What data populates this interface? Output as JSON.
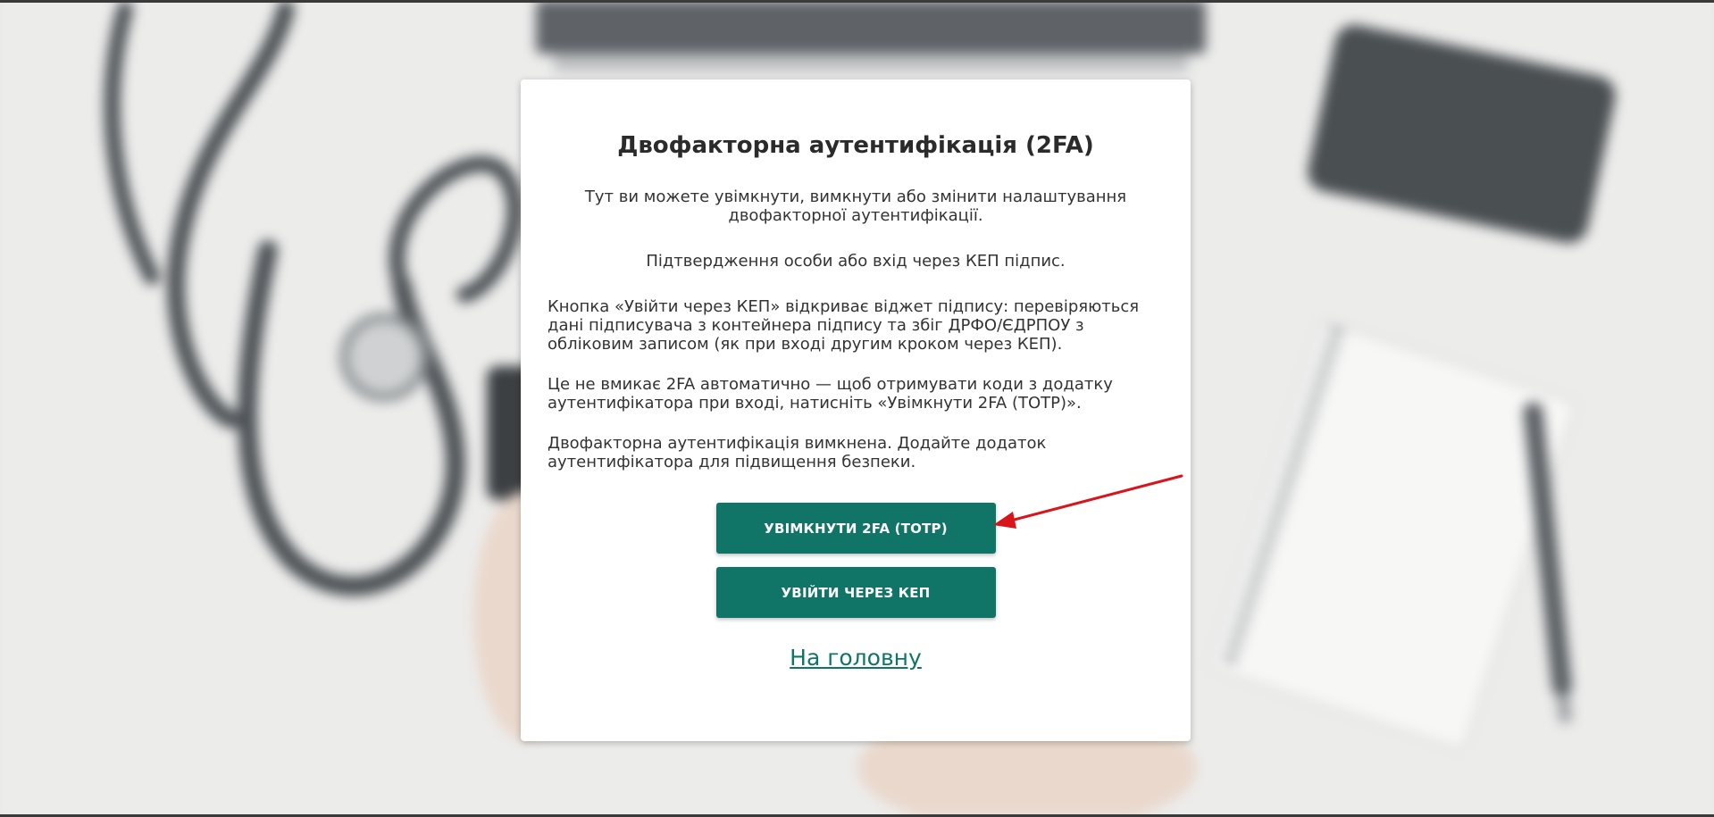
{
  "dialog": {
    "title": "Двофакторна аутентифікація (2FA)",
    "intro": "Тут ви можете увімкнути, вимкнути або змінити налаштування двофакторної аутентифікації.",
    "kep_line": "Підтвердження особи або вхід через КЕП підпис.",
    "para_kep": "Кнопка «Увійти через КЕП» відкриває віджет підпису: перевіряються дані підписувача з контейнера підпису та збіг ДРФО/ЄДРПОУ з обліковим записом (як при вході другим кроком через КЕП).",
    "para_totp": "Це не вмикає 2FA автоматично — щоб отримувати коди з додатку аутентифікатора при вході, натисніть «Увімкнути 2FA (TOTP)».",
    "para_status": "Двофакторна аутентифікація вимкнена. Додайте додаток аутентифікатора для підвищення безпеки.",
    "enable_button": "Увімкнути 2FA (TOTP)",
    "kep_button": "Увійти через КЕП",
    "home_link": "На головну"
  },
  "colors": {
    "primary": "#107566",
    "annotation_arrow": "#d9141b"
  },
  "background": {
    "description_icons": [
      "stethoscope",
      "laptop",
      "phone",
      "notebook",
      "pen",
      "hands-holding-tablet"
    ]
  }
}
